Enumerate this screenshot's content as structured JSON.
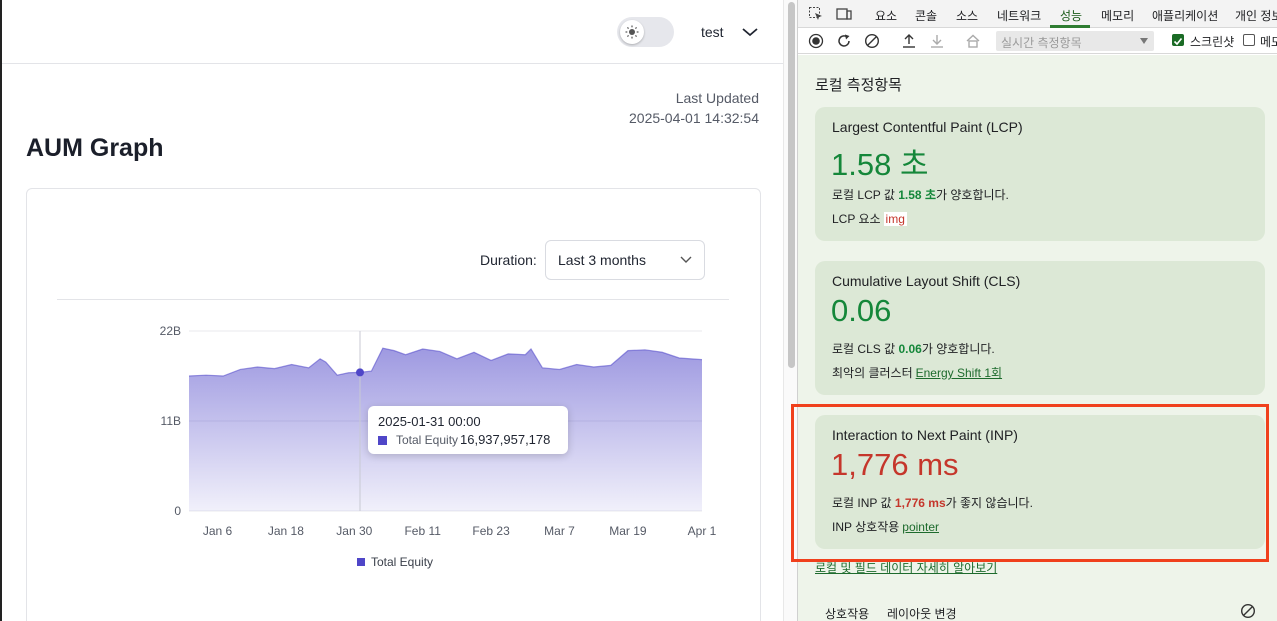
{
  "app": {
    "user_name": "test",
    "last_updated_label": "Last Updated",
    "last_updated_value": "2025-04-01 14:32:54",
    "page_title": "AUM Graph",
    "duration_label": "Duration:",
    "duration_value": "Last 3 months",
    "tooltip": {
      "date": "2025-01-31 00:00",
      "series": "Total Equity",
      "value": "16,937,957,178"
    },
    "legend_label": "Total Equity",
    "accent_color": "#4f46c8"
  },
  "chart_data": {
    "type": "area",
    "title": "",
    "xlabel": "",
    "ylabel": "",
    "ylim": [
      0,
      22000000000
    ],
    "y_ticks": [
      "0",
      "11B",
      "22B"
    ],
    "x_ticks": [
      "Jan 6",
      "Jan 18",
      "Jan 30",
      "Feb 11",
      "Feb 23",
      "Mar 7",
      "Mar 19",
      "Apr 1"
    ],
    "series": [
      {
        "name": "Total Equity",
        "color": "#4f46c8",
        "x": [
          "2025-01-01",
          "2025-01-04",
          "2025-01-07",
          "2025-01-10",
          "2025-01-13",
          "2025-01-16",
          "2025-01-19",
          "2025-01-22",
          "2025-01-24",
          "2025-01-25",
          "2025-01-27",
          "2025-01-29",
          "2025-01-31",
          "2025-02-02",
          "2025-02-04",
          "2025-02-06",
          "2025-02-08",
          "2025-02-11",
          "2025-02-14",
          "2025-02-17",
          "2025-02-20",
          "2025-02-23",
          "2025-02-26",
          "2025-03-01",
          "2025-03-02",
          "2025-03-04",
          "2025-03-07",
          "2025-03-10",
          "2025-03-13",
          "2025-03-16",
          "2025-03-19",
          "2025-03-22",
          "2025-03-25",
          "2025-03-28",
          "2025-04-01"
        ],
        "values": [
          16500000000.0,
          16600000000.0,
          16500000000.0,
          17300000000.0,
          17600000000.0,
          17400000000.0,
          17900000000.0,
          17500000000.0,
          18600000000.0,
          18200000000.0,
          16600000000.0,
          16900000000.0,
          16940000000.0,
          17100000000.0,
          19900000000.0,
          19600000000.0,
          19100000000.0,
          19800000000.0,
          19500000000.0,
          18600000000.0,
          19400000000.0,
          18400000000.0,
          19200000000.0,
          19100000000.0,
          19800000000.0,
          17500000000.0,
          17300000000.0,
          17900000000.0,
          17600000000.0,
          17800000000.0,
          19600000000.0,
          19700000000.0,
          19400000000.0,
          18700000000.0,
          18500000000.0
        ]
      }
    ],
    "highlight_point": {
      "x": "2025-01-31",
      "value": 16937957178
    },
    "grid": true,
    "legend_position": "bottom"
  },
  "devtools": {
    "tabs": [
      "요소",
      "콘솔",
      "소스",
      "네트워크",
      "성능",
      "메모리",
      "애플리케이션",
      "개인 정보"
    ],
    "active_tab": "성능",
    "metrics_select_placeholder": "실시간 측정항목",
    "screenshot_label": "스크린샷",
    "memory_label": "메모",
    "section_title": "로컬 측정항목",
    "lcp": {
      "title": "Largest Contentful Paint (LCP)",
      "value": "1.58 초",
      "desc_prefix": "로컬 LCP 값 ",
      "desc_value": "1.58 초",
      "desc_suffix": "가 양호합니다.",
      "sub_label": "LCP 요소",
      "sub_value": "img"
    },
    "cls": {
      "title": "Cumulative Layout Shift (CLS)",
      "value": "0.06",
      "desc_prefix": "로컬 CLS 값 ",
      "desc_value": "0.06",
      "desc_suffix": "가 양호합니다.",
      "sub_label": "최악의 클러스터",
      "sub_value": "Energy Shift 1회"
    },
    "inp": {
      "title": "Interaction to Next Paint (INP)",
      "value": "1,776 ms",
      "desc_prefix": "로컬 INP 값 ",
      "desc_value": "1,776 ms",
      "desc_suffix": "가 좋지 않습니다.",
      "sub_label": "INP 상호작용",
      "sub_value": "pointer"
    },
    "more_link": "로컬 및 필드 데이터 자세히 알아보기",
    "bottom_tabs": [
      "상호작용",
      "레이아웃 변경"
    ],
    "good_color": "#15873a",
    "poor_color": "#c5362b"
  }
}
